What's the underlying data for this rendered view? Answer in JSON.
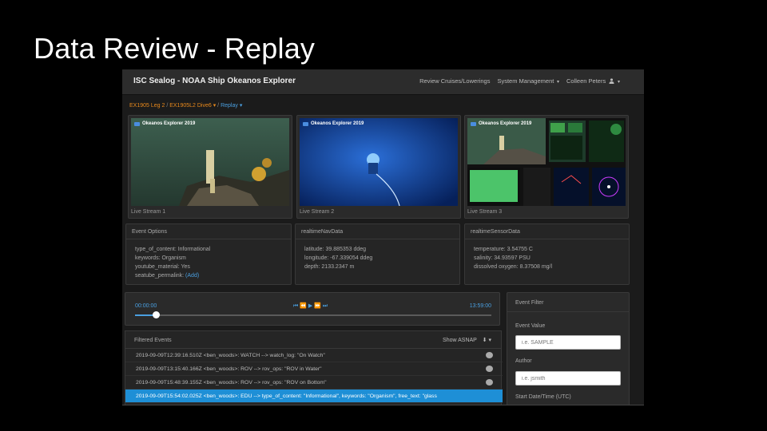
{
  "slide_title": "Data Review - Replay",
  "navbar": {
    "brand": "ISC Sealog - NOAA Ship Okeanos Explorer",
    "review": "Review Cruises/Lowerings",
    "system": "System Management",
    "user": "Colleen Peters"
  },
  "breadcrumb": {
    "cruise": "EX1905 Leg 2",
    "sep": " / ",
    "lowering": "EX1905L2 Dive6",
    "sep2": " / ",
    "mode": "Replay"
  },
  "streams": [
    {
      "watermark": "Okeanos Explorer 2019",
      "caption": "Live Stream 1"
    },
    {
      "watermark": "Okeanos Explorer 2019",
      "caption": "Live Stream 2"
    },
    {
      "watermark": "Okeanos Explorer 2019",
      "caption": "Live Stream 3"
    }
  ],
  "event_options": {
    "title": "Event Options",
    "lines": [
      "type_of_content: Informational",
      "keywords: Organism",
      "youtube_material: Yes",
      "seatube_permalink: "
    ],
    "add_link": "(Add)"
  },
  "nav_data": {
    "title": "realtimeNavData",
    "lines": [
      "latitude: 39.885353 ddeg",
      "longitude: -67.339054 ddeg",
      "depth: 2133.2347 m"
    ]
  },
  "sensor_data": {
    "title": "realtimeSensorData",
    "lines": [
      "temperature: 3.54755 C",
      "salinity: 34.93597 PSU",
      "dissolved oxygen: 8.37508 mg/l"
    ]
  },
  "player": {
    "start_time": "00:00:00",
    "end_time": "13:59:00",
    "progress": 0.06,
    "controls": "⏮ ⏪ ▶ ⏩ ⏭"
  },
  "filtered_events": {
    "title": "Filtered Events",
    "show_asnap": "Show ASNAP",
    "rows": [
      "2019-09-09T12:39:16.510Z <ben_woods>: WATCH --> watch_log: \"On Watch\"",
      "2019-09-09T13:15:40.166Z <ben_woods>: ROV --> rov_ops: \"ROV in Water\"",
      "2019-09-09T15:48:39.155Z <ben_woods>: ROV --> rov_ops: \"ROV on Bottom\"",
      "2019-09-09T15:54:02.025Z <ben_woods>: EDU --> type_of_content: \"Informational\", keywords: \"Organism\", free_text: \"glass"
    ],
    "selected_index": 3
  },
  "event_filter": {
    "title": "Event Filter",
    "value_label": "Event Value",
    "value_placeholder": "i.e. SAMPLE",
    "author_label": "Author",
    "author_placeholder": "i.e. jsmith",
    "start_label": "Start Date/Time (UTC)"
  },
  "colors": {
    "accent": "#4a9fe0",
    "cruise_orange": "#e8891c",
    "selected_row": "#1e8fd6",
    "background": "#1b1b1b"
  }
}
